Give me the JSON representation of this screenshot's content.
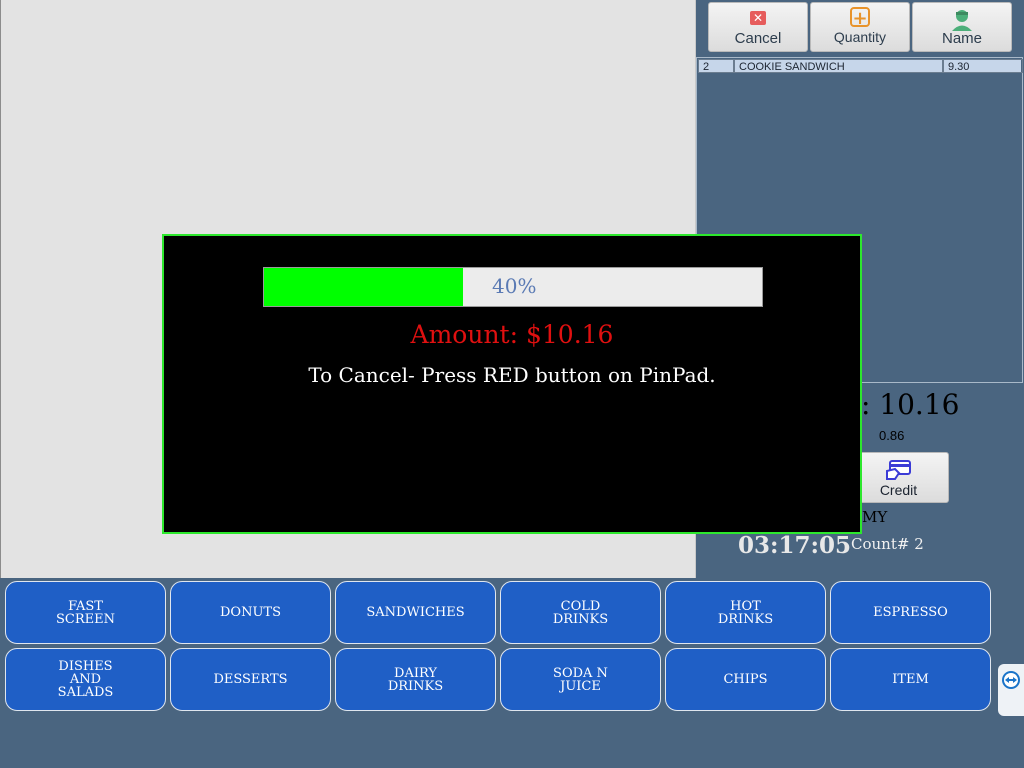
{
  "toolbar": {
    "cancel_label": "Cancel",
    "quantity_label": "Quantity",
    "name_label": "Name"
  },
  "order": {
    "items": [
      {
        "qty": "2",
        "name": "COOKIE SANDWICH",
        "price": "9.30"
      }
    ]
  },
  "totals": {
    "total_text": "l: 10.16",
    "tax_value": "0.86"
  },
  "payment": {
    "credit_label": "Credit"
  },
  "status": {
    "user_text": "MY",
    "clock": "03:17:05",
    "count": "Count# 2"
  },
  "modal": {
    "progress_percent": 40,
    "progress_text": "40%",
    "amount_text": "Amount: $10.16",
    "instruction_text": "To Cancel- Press RED button on PinPad."
  },
  "categories": {
    "row1": [
      "FAST\nSCREEN",
      "DONUTS",
      "SANDWICHES",
      "COLD\nDRINKS",
      "HOT\nDRINKS",
      "ESPRESSO"
    ],
    "row2": [
      "DISHES\nAND\nSALADS",
      "DESSERTS",
      "DAIRY\nDRINKS",
      "SODA N\nJUICE",
      "CHIPS",
      "ITEM"
    ]
  },
  "colors": {
    "category_button": "#1f5fc6",
    "progress_fill": "#00ff00",
    "amount_text": "#e01010",
    "modal_border": "#2de82d"
  },
  "icons": {
    "cancel": "close-icon",
    "quantity": "plus-icon",
    "name": "person-icon",
    "credit": "credit-card-icon",
    "side_tab": "remote-support-icon"
  }
}
